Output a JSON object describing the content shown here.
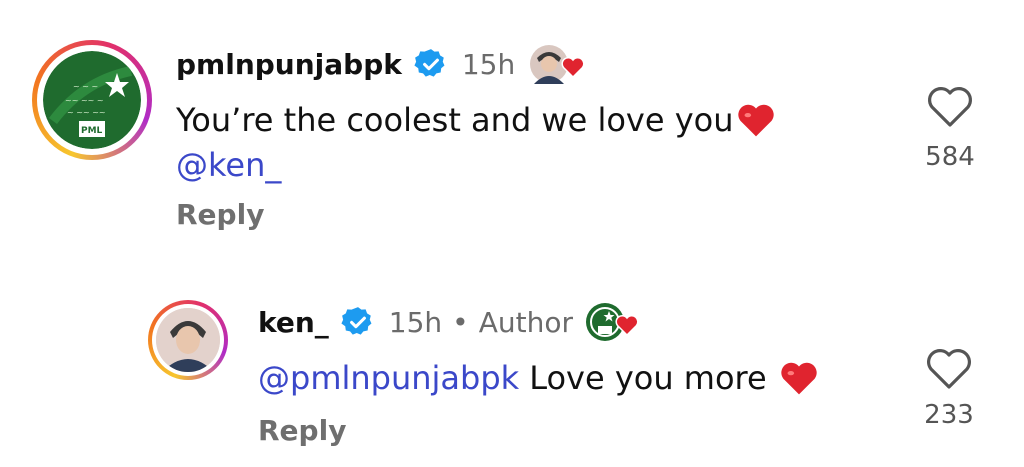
{
  "comments": [
    {
      "username": "pmlnpunjabpk",
      "verified": true,
      "time": "15h",
      "text": "You’re the coolest and we love you",
      "text_emoji": "red-heart",
      "mention": "@ken_",
      "reply_label": "Reply",
      "like_count": "584",
      "liked_by_avatar": "ken-avatar-with-heart"
    },
    {
      "username": "ken_",
      "verified": true,
      "time": "15h",
      "separator": "•",
      "author_label": "Author",
      "mention": "@pmlnpunjabpk",
      "text": "Love you more",
      "text_emoji": "red-heart",
      "reply_label": "Reply",
      "like_count": "233",
      "liked_by_avatar": "pml-logo-with-heart"
    }
  ],
  "colors": {
    "verified_blue": "#1d9bf0",
    "mention_blue": "#3b48c9",
    "heart_red": "#e0242f",
    "pml_green": "#1f6b2e"
  }
}
